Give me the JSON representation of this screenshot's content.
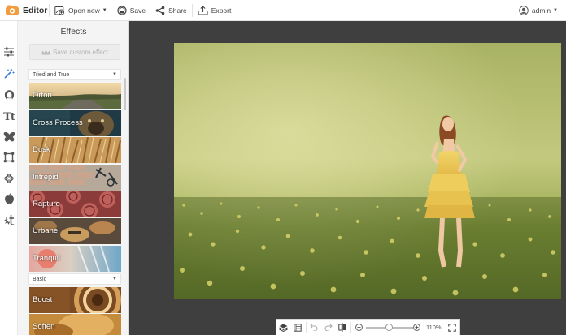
{
  "app": {
    "title": "Editor"
  },
  "toolbar": {
    "open_new": "Open new",
    "save": "Save",
    "share": "Share",
    "export": "Export"
  },
  "user": {
    "name": "admin"
  },
  "rail": {
    "items": [
      "sliders-icon",
      "magic-wand-icon",
      "face-icon",
      "text-icon",
      "butterfly-icon",
      "frame-icon",
      "texture-icon",
      "apple-icon",
      "touchup-icon"
    ],
    "active_index": 1
  },
  "panel": {
    "title": "Effects",
    "save_custom": "Save custom effect",
    "categories": [
      {
        "name": "Tried and True",
        "effects": [
          "Orton",
          "Cross Process",
          "Dusk",
          "Intrepid",
          "Rapture",
          "Urbane",
          "Tranquil"
        ]
      },
      {
        "name": "Basic",
        "effects": [
          "Boost",
          "Soften"
        ]
      }
    ]
  },
  "zoom": {
    "label": "110%",
    "level_fraction": 0.55
  },
  "colors": {
    "accent": "#f39c3d",
    "canvas_bg": "#3f3f3f"
  }
}
